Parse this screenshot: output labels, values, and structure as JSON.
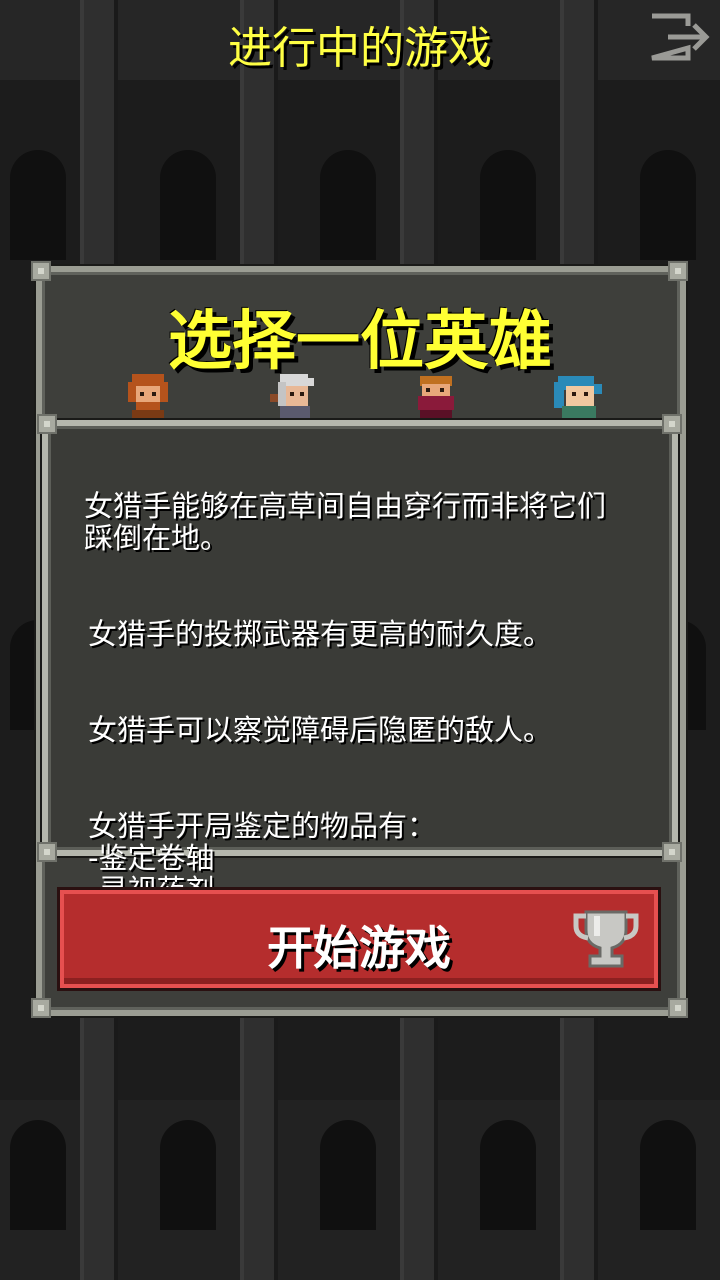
{
  "header": {
    "title": "进行中的游戏",
    "exit_icon": "exit-icon"
  },
  "dialog": {
    "title": "选择一位英雄",
    "heroes": [
      {
        "name": "warrior",
        "icon": "warrior-portrait-icon"
      },
      {
        "name": "mage",
        "icon": "mage-portrait-icon"
      },
      {
        "name": "rogue",
        "icon": "rogue-portrait-icon"
      },
      {
        "name": "huntress",
        "icon": "huntress-portrait-icon"
      }
    ],
    "description": {
      "para1": "女猎手能够在高草间自由穿行而非将它们\n踩倒在地。",
      "para2": "女猎手的投掷武器有更高的耐久度。",
      "para3": "女猎手可以察觉障碍后隐匿的敌人。",
      "para4": "女猎手开局鉴定的物品有：\n-鉴定卷轴\n-灵视药剂\n-催眠卷轴"
    },
    "start_button": "开始游戏",
    "trophy_icon": "trophy-icon"
  },
  "colors": {
    "title_yellow": "#ffff44",
    "button_red": "#b52d2d",
    "panel_grey": "#3e3f3b"
  }
}
